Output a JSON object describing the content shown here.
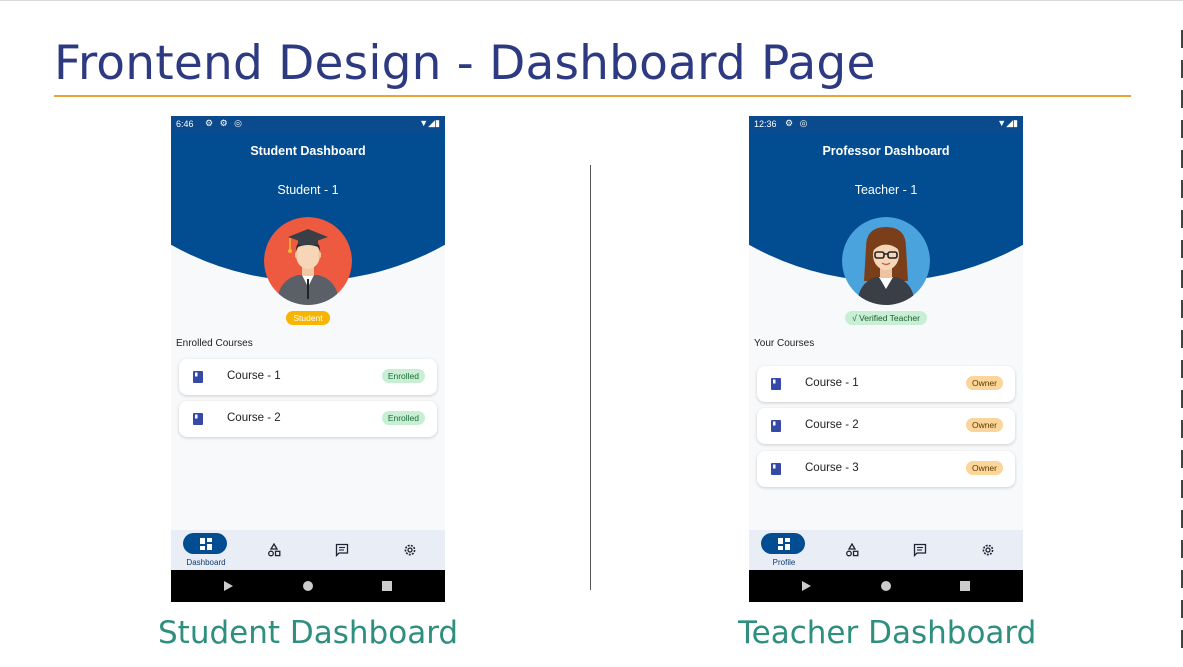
{
  "slide": {
    "title": "Frontend Design - Dashboard Page",
    "captions": {
      "student": "Student Dashboard",
      "teacher": "Teacher Dashboard"
    },
    "colors": {
      "title": "#2d3a82",
      "rule": "#e8a33a",
      "caption": "#2f8f7f",
      "header": "#024c91"
    }
  },
  "student_phone": {
    "status_time": "6:46",
    "dashboard_title": "Student Dashboard",
    "user_name": "Student - 1",
    "role_badge": "Student",
    "section_label": "Enrolled Courses",
    "courses": [
      {
        "name": "Course - 1",
        "status": "Enrolled"
      },
      {
        "name": "Course - 2",
        "status": "Enrolled"
      }
    ],
    "nav": {
      "active_label": "Dashboard",
      "items": [
        "dashboard-icon",
        "shapes-icon",
        "chat-icon",
        "settings-icon"
      ]
    }
  },
  "teacher_phone": {
    "status_time": "12:36",
    "dashboard_title": "Professor Dashboard",
    "user_name": "Teacher - 1",
    "role_badge": "√ Verified Teacher",
    "section_label": "Your Courses",
    "courses": [
      {
        "name": "Course - 1",
        "status": "Owner"
      },
      {
        "name": "Course - 2",
        "status": "Owner"
      },
      {
        "name": "Course - 3",
        "status": "Owner"
      }
    ],
    "nav": {
      "active_label": "Profile",
      "items": [
        "profile-icon",
        "shapes-icon",
        "chat-icon",
        "settings-icon"
      ]
    }
  }
}
